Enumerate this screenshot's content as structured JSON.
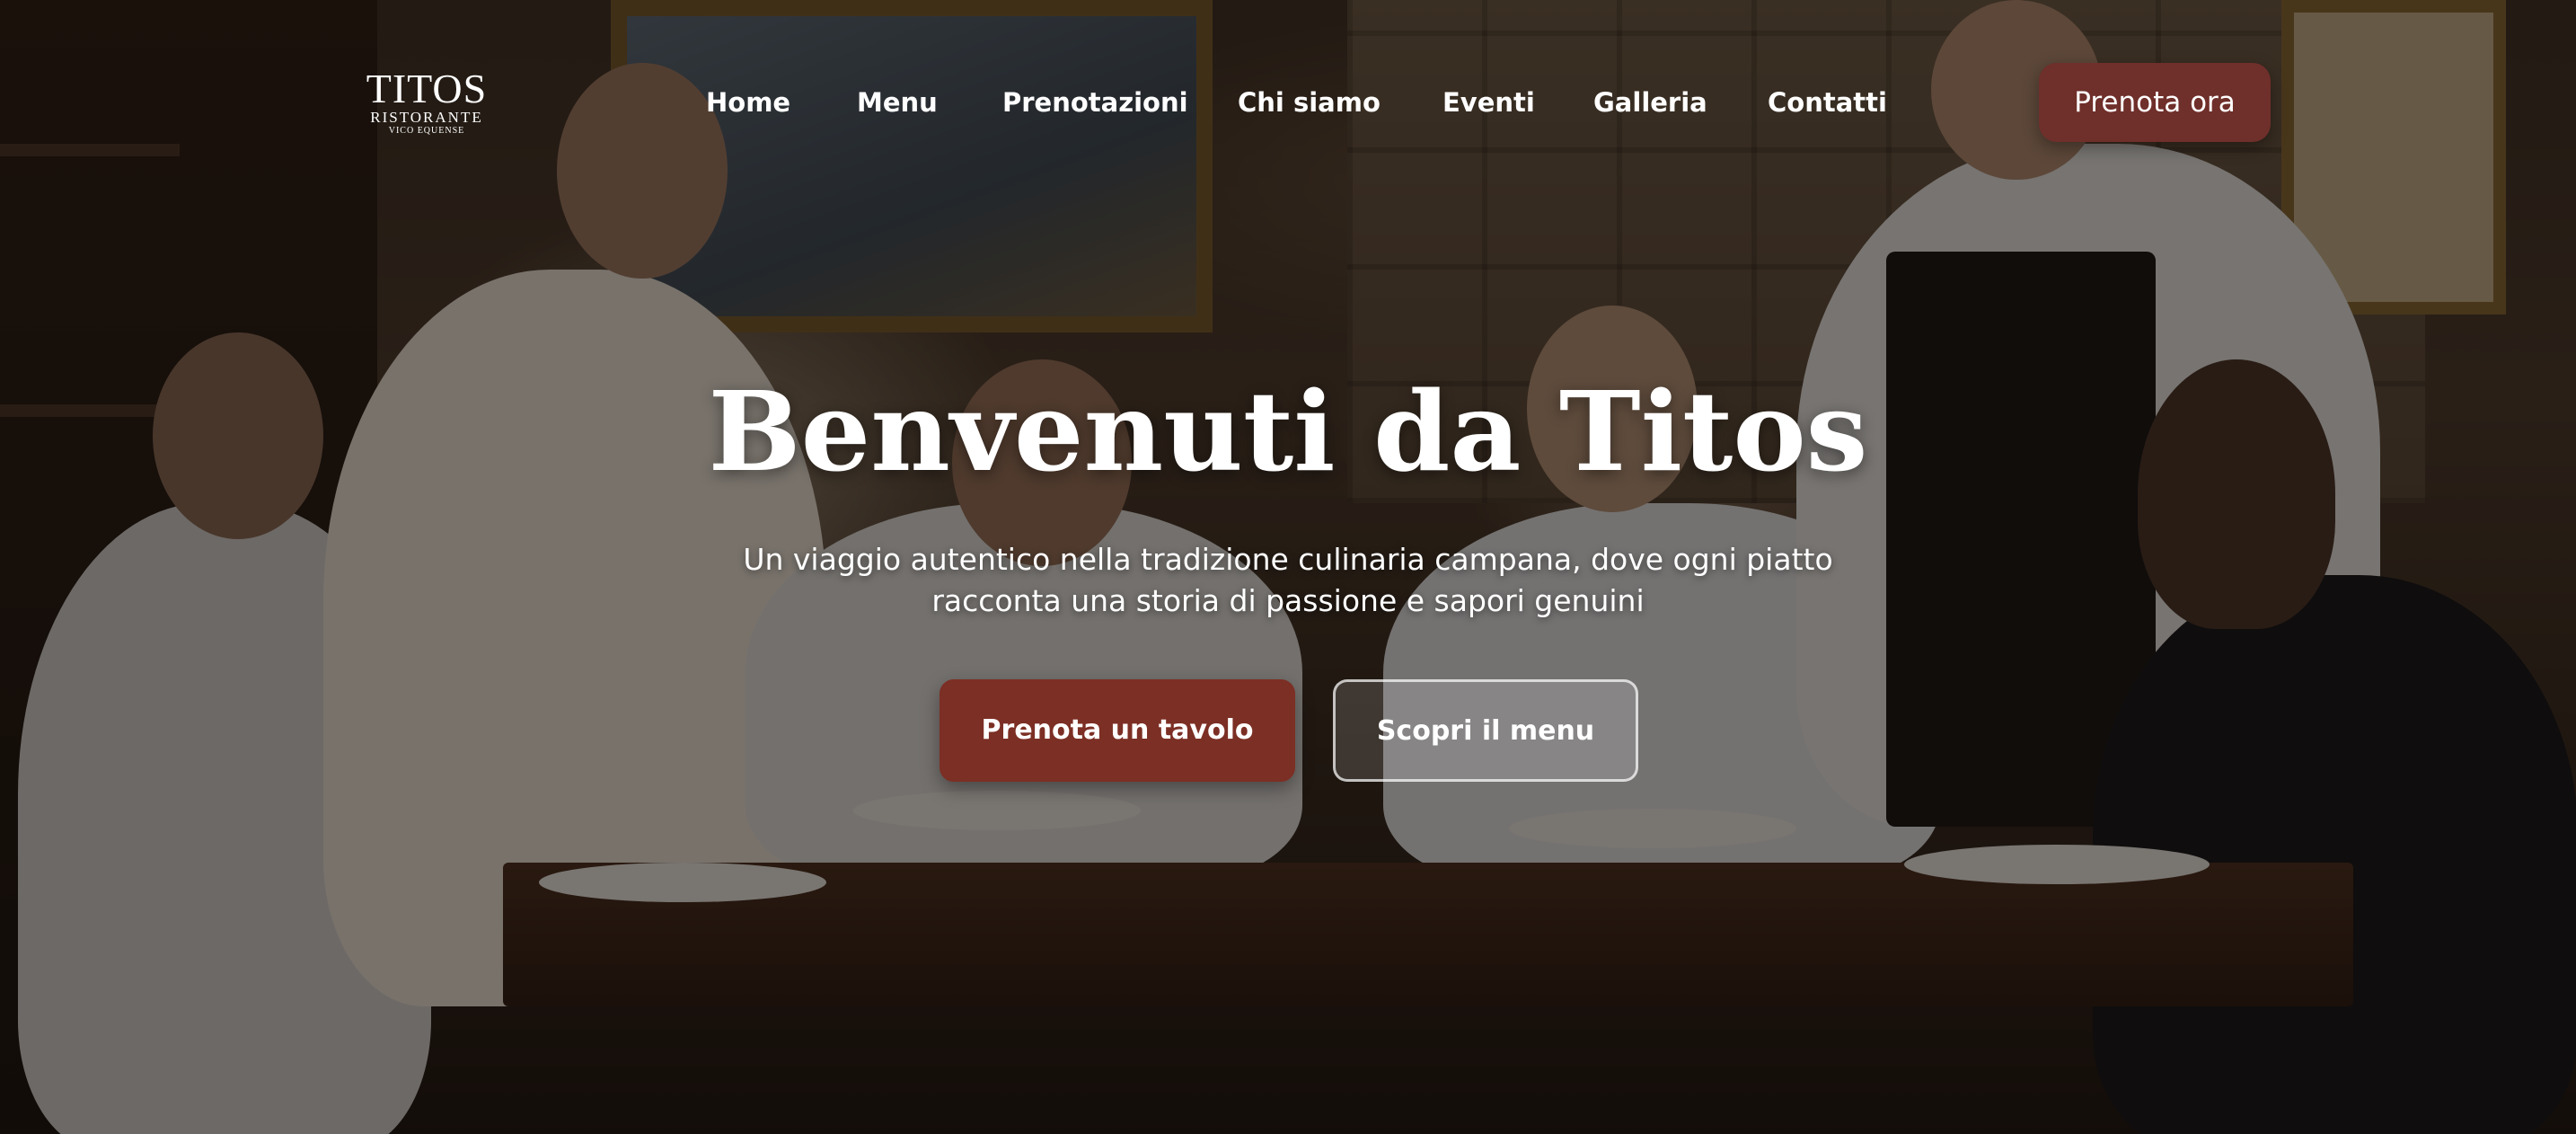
{
  "logo": {
    "name": "TITOS",
    "subtitle": "RISTORANTE",
    "location": "VICO EQUENSE"
  },
  "nav": {
    "items": [
      {
        "label": "Home"
      },
      {
        "label": "Menu"
      },
      {
        "label": "Prenotazioni"
      },
      {
        "label": "Chi siamo"
      },
      {
        "label": "Eventi"
      },
      {
        "label": "Galleria"
      },
      {
        "label": "Contatti"
      }
    ],
    "cta_label": "Prenota ora"
  },
  "hero": {
    "title": "Benvenuti da Titos",
    "subtitle_line1": "Un viaggio autentico nella tradizione culinaria campana, dove ogni piatto",
    "subtitle_line2": "racconta una storia di passione e sapori genuini",
    "primary_button": "Prenota un tavolo",
    "secondary_button": "Scopri il menu"
  },
  "colors": {
    "accent": "#7c2f24",
    "nav_cta": "#6f2f2a",
    "text": "#ffffff"
  }
}
